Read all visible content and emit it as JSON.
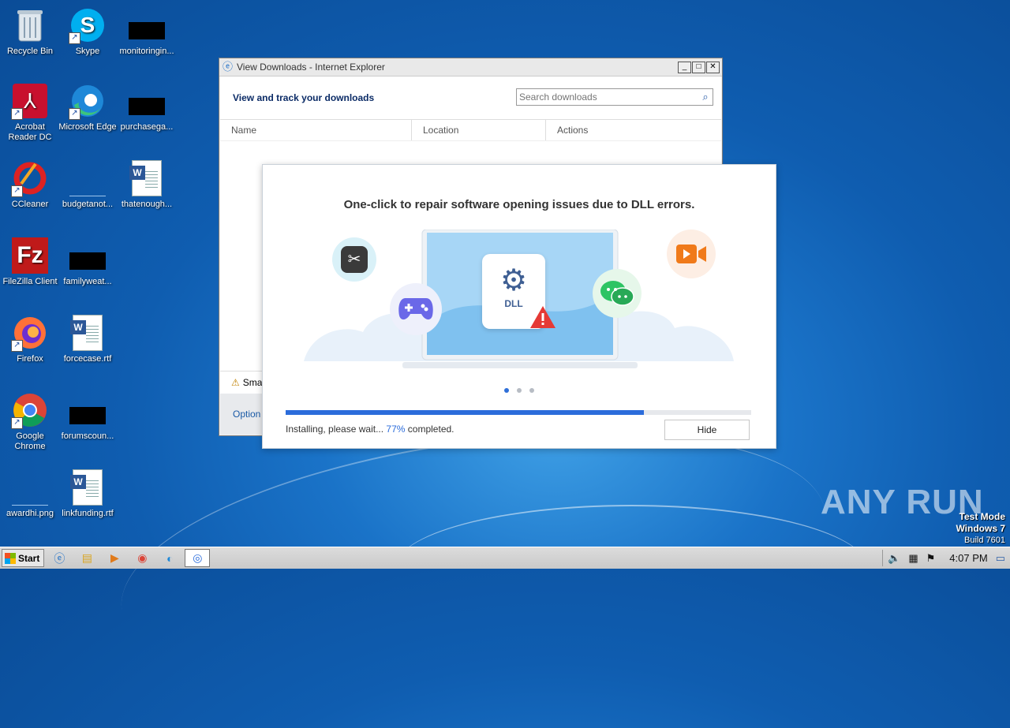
{
  "desktop": {
    "icons": [
      {
        "label": "Recycle Bin"
      },
      {
        "label": "Skype"
      },
      {
        "label": "monitoringin..."
      },
      {
        "label": "Acrobat Reader DC"
      },
      {
        "label": "Microsoft Edge"
      },
      {
        "label": "purchasega..."
      },
      {
        "label": "CCleaner"
      },
      {
        "label": "budgetanot..."
      },
      {
        "label": "thatenough..."
      },
      {
        "label": "FileZilla Client"
      },
      {
        "label": "familyweat..."
      },
      {
        "label": "Firefox"
      },
      {
        "label": "forcecase.rtf"
      },
      {
        "label": "Google Chrome"
      },
      {
        "label": "forumscoun..."
      },
      {
        "label": "awardhi.png"
      },
      {
        "label": "linkfunding.rtf"
      }
    ]
  },
  "ie_window": {
    "title": "View Downloads - Internet Explorer",
    "header": "View and track your downloads",
    "search_placeholder": "Search downloads",
    "columns": [
      "Name",
      "Location",
      "Actions"
    ],
    "footer_smartscreen": "Sma",
    "footer_options": "Option"
  },
  "installer": {
    "headline": "One-click to repair software opening issues due to DLL errors.",
    "dll_label": "DLL",
    "progress_fraction": 0.77,
    "status_prefix": "Installing, please wait...",
    "status_percent": "77%",
    "status_suffix": "completed.",
    "hide_label": "Hide",
    "carousel_active_index": 0,
    "carousel_count": 3
  },
  "taskbar": {
    "start_label": "Start",
    "clock": "4:07 PM"
  },
  "watermark": "ANY RUN",
  "test_mode": {
    "line1": "Test Mode",
    "line2": "Windows 7",
    "line3": "Build 7601"
  },
  "colors": {
    "accent": "#2b6cdb",
    "desktop_blue": "#1a73c8"
  }
}
